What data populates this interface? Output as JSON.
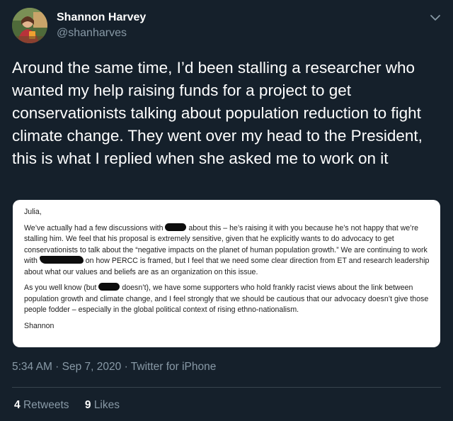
{
  "author": {
    "name": "Shannon Harvey",
    "handle": "@shanharves"
  },
  "tweet": {
    "text": "Around the same time, I’d been stalling a researcher who wanted my help raising funds for a project to get conservationists talking about population reduction to fight climate change. They went over my head to the President, this is what I replied when she asked me to work on it"
  },
  "attachment": {
    "salutation": "Julia,",
    "p1_a": "We’ve actually had a few discussions with",
    "p1_b": "about this – he’s raising it with you because he’s not happy that we’re stalling him. We feel that his proposal is extremely sensitive, given that he explicitly wants to do advocacy to get conservationists to talk about the “negative impacts on the planet of human population growth.” We are continuing to work with",
    "p1_c": "on how PERCC is framed, but I feel that we need some clear direction from ET and research leadership about what our values and beliefs are as an organization on this issue.",
    "p2_a": "As you well know (but",
    "p2_b": "doesn’t), we have some supporters who hold frankly racist views about the link between population growth and climate change, and I feel strongly that we should be cautious that our advocacy doesn’t give those people fodder – especially in the global political context of rising ethno-nationalism.",
    "signoff": "Shannon"
  },
  "meta": {
    "time": "5:34 AM",
    "sep1": " · ",
    "date": "Sep 7, 2020",
    "sep2": " · ",
    "source": "Twitter for iPhone"
  },
  "stats": {
    "retweets_count": "4",
    "retweets_label": "Retweets",
    "likes_count": "9",
    "likes_label": "Likes"
  },
  "icons": {
    "caret": "chevron-down-icon"
  },
  "colors": {
    "background": "#15202b",
    "secondary_text": "#8899a6",
    "divider": "#38444d"
  }
}
